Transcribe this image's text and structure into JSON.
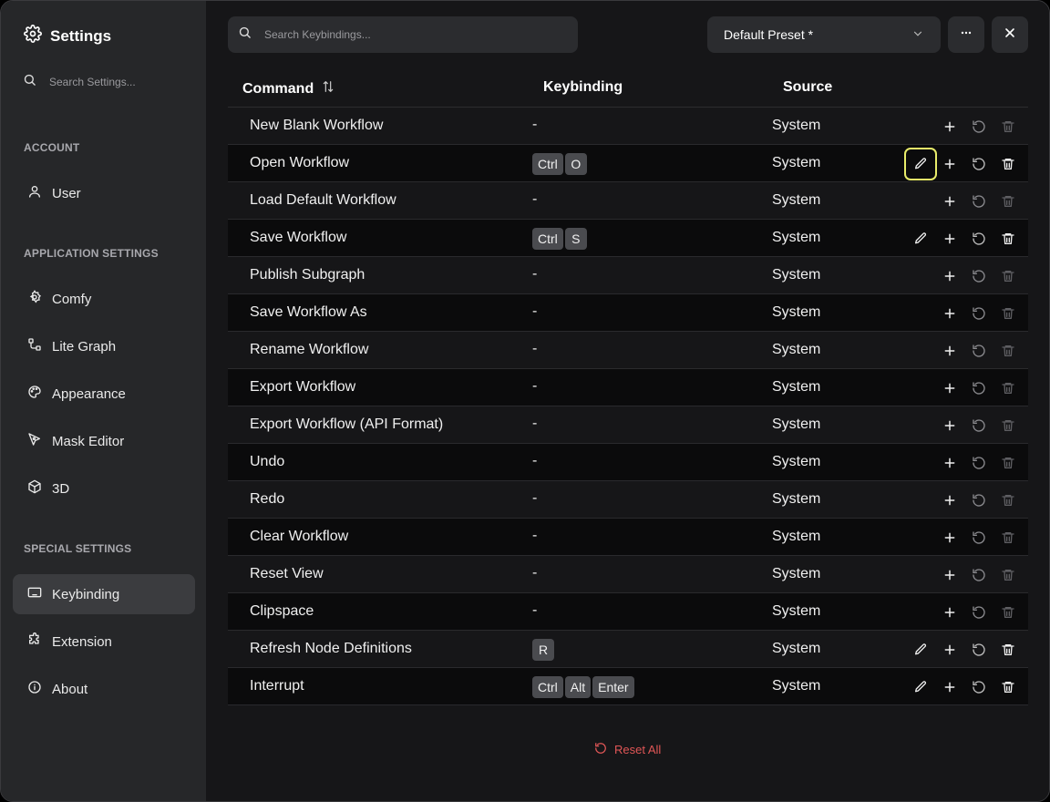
{
  "sidebar": {
    "title": "Settings",
    "search_placeholder": "Search Settings...",
    "sections": [
      {
        "label": "ACCOUNT"
      },
      {
        "label": "APPLICATION SETTINGS"
      },
      {
        "label": "SPECIAL SETTINGS"
      }
    ],
    "items": [
      {
        "label": "User",
        "icon": "user-icon"
      },
      {
        "label": "Comfy",
        "icon": "gear-icon"
      },
      {
        "label": "Lite Graph",
        "icon": "graph-icon"
      },
      {
        "label": "Appearance",
        "icon": "palette-icon"
      },
      {
        "label": "Mask Editor",
        "icon": "pen-tool-icon"
      },
      {
        "label": "3D",
        "icon": "cube-icon"
      },
      {
        "label": "Keybinding",
        "icon": "keyboard-icon",
        "active": true
      },
      {
        "label": "Extension",
        "icon": "puzzle-icon"
      },
      {
        "label": "About",
        "icon": "info-icon"
      }
    ]
  },
  "toolbar": {
    "search_placeholder": "Search Keybindings...",
    "preset_label": "Default Preset *"
  },
  "table": {
    "headers": {
      "command": "Command",
      "keybinding": "Keybinding",
      "source": "Source"
    },
    "rows": [
      {
        "command": "New Blank Workflow",
        "keys": [],
        "source": "System",
        "editable": false
      },
      {
        "command": "Open Workflow",
        "keys": [
          "Ctrl",
          "O"
        ],
        "source": "System",
        "editable": true,
        "focused": true
      },
      {
        "command": "Load Default Workflow",
        "keys": [],
        "source": "System",
        "editable": false
      },
      {
        "command": "Save Workflow",
        "keys": [
          "Ctrl",
          "S"
        ],
        "source": "System",
        "editable": true
      },
      {
        "command": "Publish Subgraph",
        "keys": [],
        "source": "System",
        "editable": false
      },
      {
        "command": "Save Workflow As",
        "keys": [],
        "source": "System",
        "editable": false
      },
      {
        "command": "Rename Workflow",
        "keys": [],
        "source": "System",
        "editable": false
      },
      {
        "command": "Export Workflow",
        "keys": [],
        "source": "System",
        "editable": false
      },
      {
        "command": "Export Workflow (API Format)",
        "keys": [],
        "source": "System",
        "editable": false
      },
      {
        "command": "Undo",
        "keys": [],
        "source": "System",
        "editable": false
      },
      {
        "command": "Redo",
        "keys": [],
        "source": "System",
        "editable": false
      },
      {
        "command": "Clear Workflow",
        "keys": [],
        "source": "System",
        "editable": false
      },
      {
        "command": "Reset View",
        "keys": [],
        "source": "System",
        "editable": false
      },
      {
        "command": "Clipspace",
        "keys": [],
        "source": "System",
        "editable": false
      },
      {
        "command": "Refresh Node Definitions",
        "keys": [
          "R"
        ],
        "source": "System",
        "editable": true
      },
      {
        "command": "Interrupt",
        "keys": [
          "Ctrl",
          "Alt",
          "Enter"
        ],
        "source": "System",
        "editable": true
      }
    ],
    "empty_key": "-"
  },
  "footer": {
    "reset_all_label": "Reset All"
  },
  "colors": {
    "accent_focus": "#e8ec6a",
    "danger": "#e05656",
    "sidebar_bg": "#262729",
    "main_bg": "#161618"
  }
}
